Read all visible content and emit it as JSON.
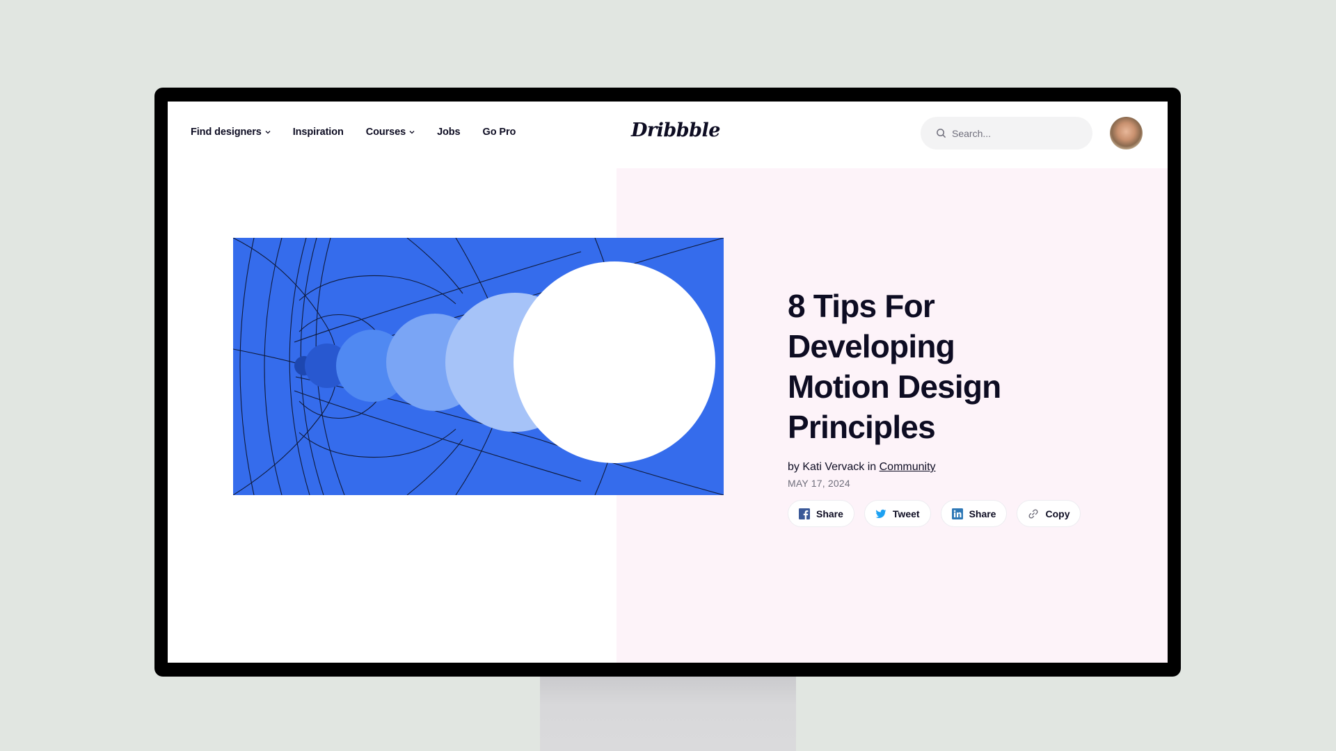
{
  "nav": {
    "links": [
      {
        "label": "Find designers",
        "has_dropdown": true
      },
      {
        "label": "Inspiration",
        "has_dropdown": false
      },
      {
        "label": "Courses",
        "has_dropdown": true
      },
      {
        "label": "Jobs",
        "has_dropdown": false
      },
      {
        "label": "Go Pro",
        "has_dropdown": false
      }
    ],
    "logo": "Dribbble",
    "search": {
      "placeholder": "Search...",
      "value": "",
      "icon": "search-icon"
    },
    "avatar": "user-avatar"
  },
  "hero": {
    "image": "motion-design-circles-illustration",
    "colors": {
      "background": "#356cec",
      "circles": [
        "#1d4fb8",
        "#2858d0",
        "#5089f2",
        "#7aa5f5",
        "#a6c3f8",
        "#ffffff"
      ],
      "panel": "#fdf3f9"
    }
  },
  "article": {
    "title": "8 Tips For Developing Motion Design Principles",
    "title_lines": [
      "8 Tips For",
      "Developing",
      "Motion Design",
      "Principles"
    ],
    "byline_prefix": "by Kati Vervack in",
    "category": "Community",
    "date": "MAY 17, 2024",
    "share_buttons": [
      {
        "label": "Share",
        "icon": "facebook-icon"
      },
      {
        "label": "Tweet",
        "icon": "twitter-icon"
      },
      {
        "label": "Share",
        "icon": "linkedin-icon"
      },
      {
        "label": "Copy",
        "icon": "link-icon"
      }
    ]
  }
}
